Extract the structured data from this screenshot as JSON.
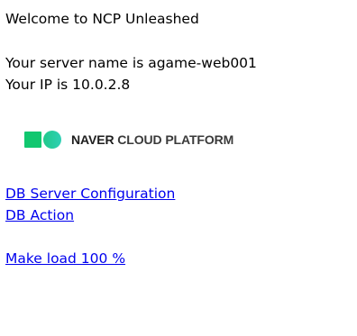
{
  "page": {
    "welcome": "Welcome to NCP Unleashed",
    "server_name_line": "Your server name is agame-web001",
    "ip_line": "Your IP is 10.0.2.8"
  },
  "logo": {
    "text_bold": "NAVER",
    "text_rest": " CLOUD PLATFORM",
    "icon": "naver-cloud-logo-icon",
    "colors": {
      "square": "#11c76f",
      "circle_start": "#20c98a",
      "circle_end": "#2fd0b4"
    }
  },
  "links": {
    "db_config": "DB Server Configuration",
    "db_action": "DB Action",
    "load": "Make load 100 %"
  },
  "colors": {
    "link": "#0000ee",
    "text": "#000000"
  }
}
